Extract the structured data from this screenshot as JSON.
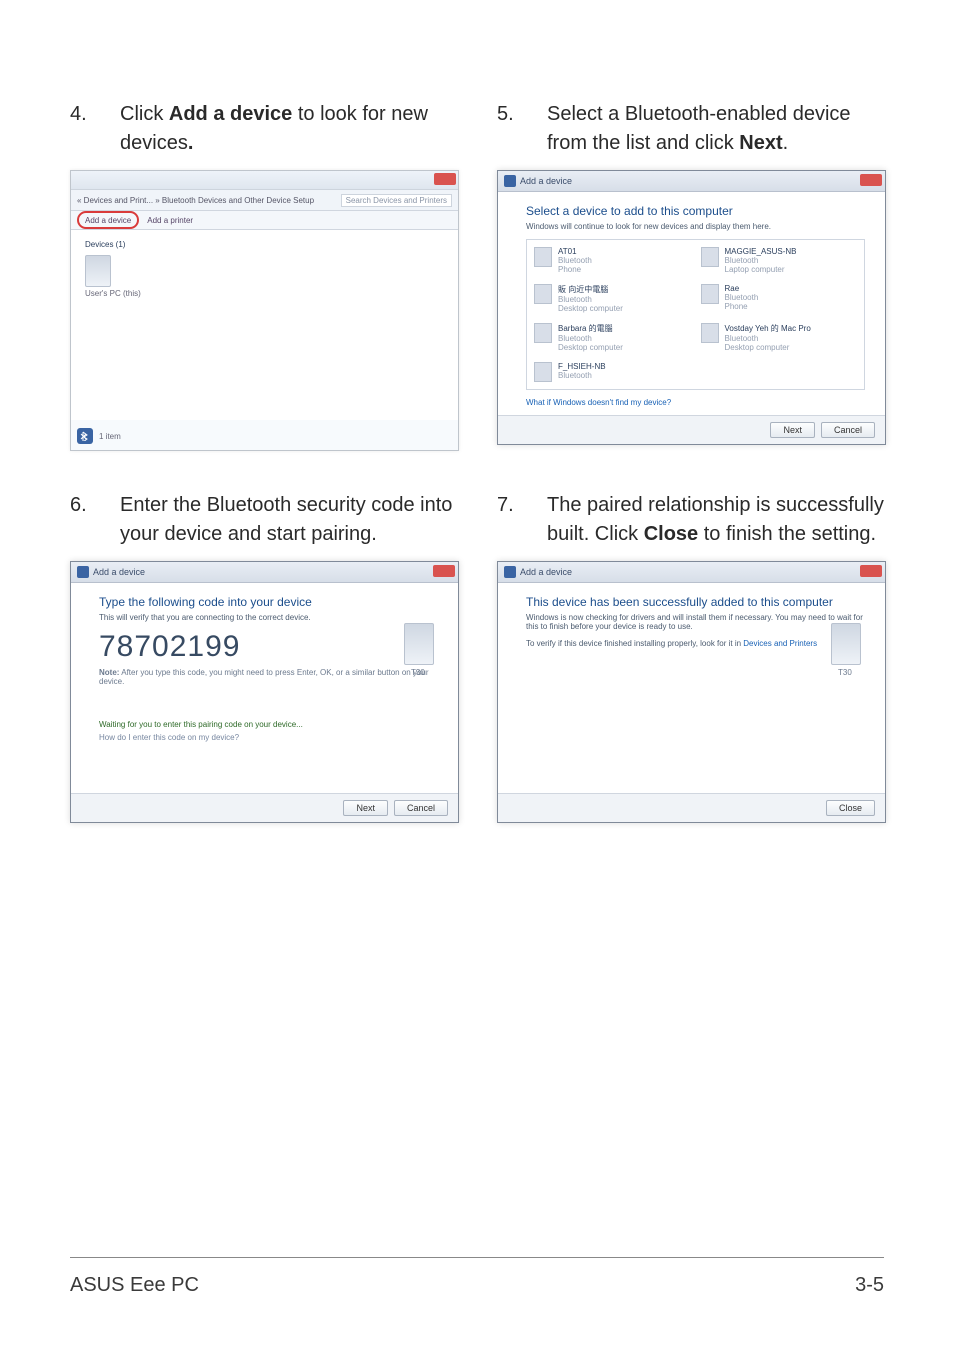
{
  "steps": {
    "s4": {
      "num": "4.",
      "pre": "Click ",
      "bold": "Add a device",
      "post": " to look for new devices",
      "tail": "."
    },
    "s5": {
      "num": "5.",
      "pre": "Select a Bluetooth-enabled device from the list and click ",
      "bold": "Next",
      "post": "."
    },
    "s6": {
      "num": "6.",
      "text": "Enter the Bluetooth security code into your device and start pairing."
    },
    "s7": {
      "num": "7.",
      "pre": "The paired relationship is successfully built. Click ",
      "bold": "Close",
      "post": " to finish the setting."
    }
  },
  "shot4": {
    "breadcrumb": "« Devices and Print... » Bluetooth Devices and Other Device Setup",
    "search_placeholder": "Search Devices and Printers",
    "add_device": "Add a device",
    "add_printer": "Add a printer",
    "section": "Devices (1)",
    "device_label": "User's PC (this)",
    "footer_count": "1 item"
  },
  "wizard5": {
    "title": "Add a device",
    "heading": "Select a device to add to this computer",
    "sub": "Windows will continue to look for new devices and display them here.",
    "items": [
      {
        "name": "AT01",
        "line2": "Bluetooth",
        "line3": "Phone"
      },
      {
        "name": "MAGGIE_ASUS-NB",
        "line2": "Bluetooth",
        "line3": "Laptop computer"
      },
      {
        "name": "販 向近中電腦",
        "line2": "Bluetooth",
        "line3": "Desktop computer"
      },
      {
        "name": "Rae",
        "line2": "Bluetooth",
        "line3": "Phone"
      },
      {
        "name": "Barbara 的電腦",
        "line2": "Bluetooth",
        "line3": "Desktop computer"
      },
      {
        "name": "Vostday Yeh 的 Mac Pro",
        "line2": "Bluetooth",
        "line3": "Desktop computer"
      },
      {
        "name": "F_HSIEH-NB",
        "line2": "Bluetooth",
        "line3": ""
      }
    ],
    "link": "What if Windows doesn't find my device?",
    "btn_next": "Next",
    "btn_cancel": "Cancel"
  },
  "wizard6": {
    "title": "Add a device",
    "heading": "Type the following code into your device",
    "sub": "This will verify that you are connecting to the correct device.",
    "code": "78702199",
    "note_label": "Note:",
    "note": "After you type this code, you might need to press Enter, OK, or a similar button on your device.",
    "device_caption": "T30",
    "status": "Waiting for you to enter this pairing code on your device...",
    "status_link": "How do I enter this code on my device?",
    "btn_next": "Next",
    "btn_cancel": "Cancel"
  },
  "wizard7": {
    "title": "Add a device",
    "heading": "This device has been successfully added to this computer",
    "line1": "Windows is now checking for drivers and will install them if necessary. You may need to wait for this to finish before your device is ready to use.",
    "line2": "To verify if this device finished installing properly, look for it in ",
    "line2_link": "Devices and Printers",
    "device_caption": "T30",
    "btn_close": "Close"
  },
  "footer": {
    "left": "ASUS Eee PC",
    "right": "3-5"
  }
}
